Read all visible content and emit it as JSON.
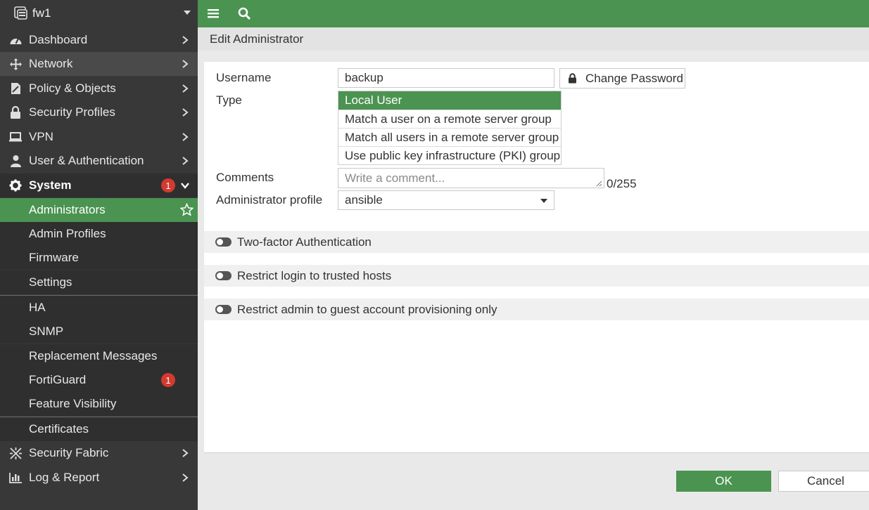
{
  "device": {
    "name": "fw1"
  },
  "sidebar": {
    "items": [
      {
        "label": "Dashboard"
      },
      {
        "label": "Network"
      },
      {
        "label": "Policy & Objects"
      },
      {
        "label": "Security Profiles"
      },
      {
        "label": "VPN"
      },
      {
        "label": "User & Authentication"
      },
      {
        "label": "System",
        "badge": "1"
      },
      {
        "label": "Administrators"
      },
      {
        "label": "Admin Profiles"
      },
      {
        "label": "Firmware"
      },
      {
        "label": "Settings"
      },
      {
        "label": "HA"
      },
      {
        "label": "SNMP"
      },
      {
        "label": "Replacement Messages"
      },
      {
        "label": "FortiGuard",
        "badge": "1"
      },
      {
        "label": "Feature Visibility"
      },
      {
        "label": "Certificates"
      },
      {
        "label": "Security Fabric"
      },
      {
        "label": "Log & Report"
      }
    ]
  },
  "page": {
    "title": "Edit Administrator"
  },
  "form": {
    "username_label": "Username",
    "username_value": "backup",
    "change_password_label": "Change Password",
    "type_label": "Type",
    "type_options": [
      "Local User",
      "Match a user on a remote server group",
      "Match all users in a remote server group",
      "Use public key infrastructure (PKI) group"
    ],
    "comments_label": "Comments",
    "comments_placeholder": "Write a comment...",
    "comments_counter": "0/255",
    "admin_profile_label": "Administrator profile",
    "admin_profile_value": "ansible"
  },
  "sections": [
    {
      "label": "Two-factor Authentication",
      "enabled": false
    },
    {
      "label": "Restrict login to trusted hosts",
      "enabled": false
    },
    {
      "label": "Restrict admin to guest account provisioning only",
      "enabled": false
    }
  ],
  "footer": {
    "ok_label": "OK",
    "cancel_label": "Cancel"
  },
  "colors": {
    "accent": "#4b9351",
    "sidebar_bg": "#383838",
    "badge": "#d43a2f"
  }
}
